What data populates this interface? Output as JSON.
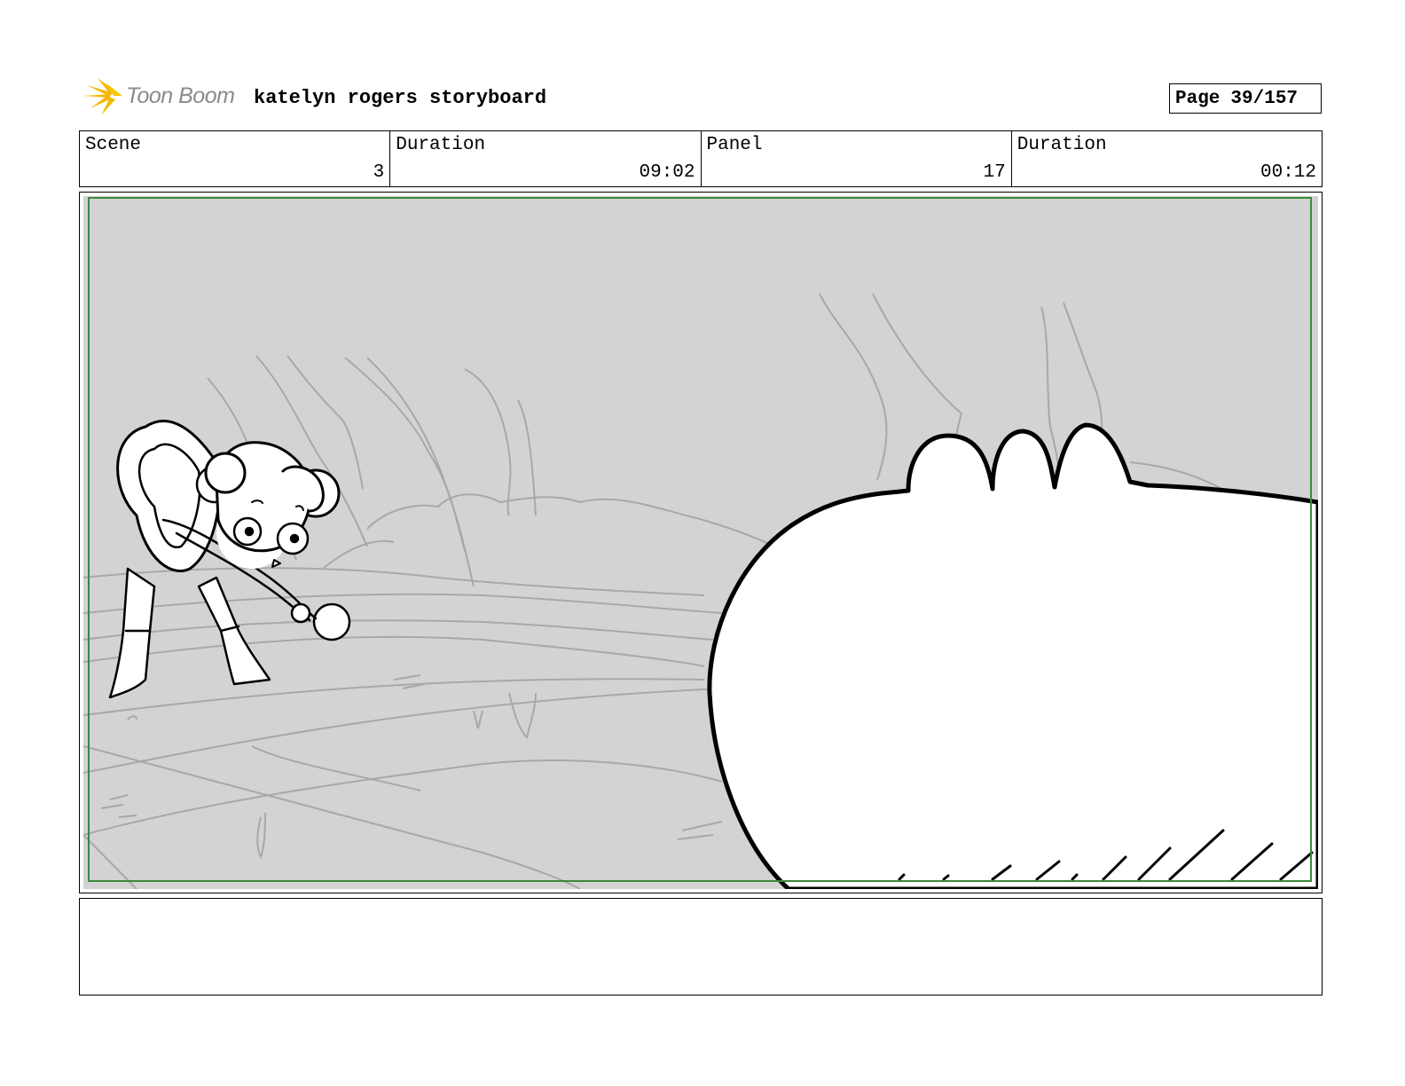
{
  "header": {
    "logo_text": "Toon Boom",
    "title": "katelyn rogers storyboard",
    "page_label": "Page",
    "page_value": "39/157"
  },
  "info": {
    "scene_label": "Scene",
    "scene_value": "3",
    "scene_duration_label": "Duration",
    "scene_duration_value": "09:02",
    "panel_label": "Panel",
    "panel_value": "17",
    "panel_duration_label": "Duration",
    "panel_duration_value": "00:12"
  },
  "panel": {
    "background_color": "#d3d3d3",
    "safe_area_color": "#3a8a3a"
  },
  "notes": {
    "text": ""
  }
}
